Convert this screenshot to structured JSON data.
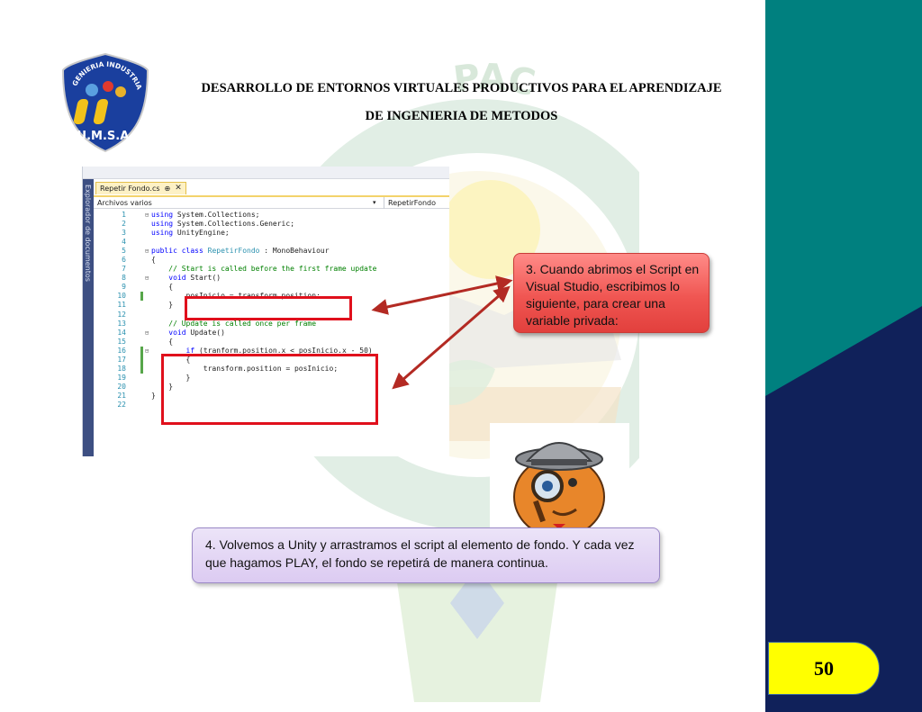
{
  "header": {
    "line1": "DESARROLLO DE ENTORNOS VIRTUALES PRODUCTIVOS PARA EL APRENDIZAJE",
    "line2": "DE INGENIERIA DE METODOS"
  },
  "logo": {
    "arc_text": "INGENIERIA INDUSTRIAL",
    "initials": "U.M.S.A."
  },
  "watermark": {
    "arc_text": "PAC"
  },
  "editor": {
    "tab_label": "Repetir Fondo.cs",
    "tab_pin": "⊕",
    "tab_close": "✕",
    "side_label": "Explorador de documentos",
    "nav_left": "Archivos varios",
    "nav_right": "RepetirFondo",
    "code": [
      {
        "n": "1",
        "text": "using System.Collections;",
        "fold": "⊟"
      },
      {
        "n": "2",
        "text": "using System.Collections.Generic;"
      },
      {
        "n": "3",
        "text": "using UnityEngine;"
      },
      {
        "n": "4",
        "text": ""
      },
      {
        "n": "5",
        "text": "public class RepetirFondo : MonoBehaviour",
        "fold": "⊟"
      },
      {
        "n": "6",
        "text": "{"
      },
      {
        "n": "7",
        "text": "    // Start is called before the first frame update"
      },
      {
        "n": "8",
        "text": "    void Start()",
        "fold": "⊟"
      },
      {
        "n": "9",
        "text": "    {"
      },
      {
        "n": "10",
        "text": "        posInicio = transform.position;",
        "changed": true
      },
      {
        "n": "11",
        "text": "    }"
      },
      {
        "n": "12",
        "text": ""
      },
      {
        "n": "13",
        "text": "    // Update is called once per frame"
      },
      {
        "n": "14",
        "text": "    void Update()",
        "fold": "⊟"
      },
      {
        "n": "15",
        "text": "    {"
      },
      {
        "n": "16",
        "text": "        if (tranform.position.x < posInicio.x - 50)",
        "fold": "⊟",
        "changed": true
      },
      {
        "n": "17",
        "text": "        {",
        "changed": true
      },
      {
        "n": "18",
        "text": "            transform.position = posInicio;",
        "changed": true
      },
      {
        "n": "19",
        "text": "        }"
      },
      {
        "n": "20",
        "text": "    }"
      },
      {
        "n": "21",
        "text": "}"
      },
      {
        "n": "22",
        "text": ""
      }
    ]
  },
  "callout3": {
    "text": "3. Cuando abrimos el Script en Visual Studio, escribimos lo siguiente, para crear una variable privada:"
  },
  "callout4": {
    "text": "4. Volvemos a Unity y arrastramos el script al elemento de fondo. Y cada vez que hagamos PLAY, el fondo se repetirá de manera continua."
  },
  "page_number": "50",
  "colors": {
    "teal": "#00807f",
    "navy": "#10215a",
    "highlight_red": "#e0101c",
    "callout_red": "#f05652",
    "callout_lilac": "#dccbf2",
    "page_yellow": "#ffff00"
  }
}
